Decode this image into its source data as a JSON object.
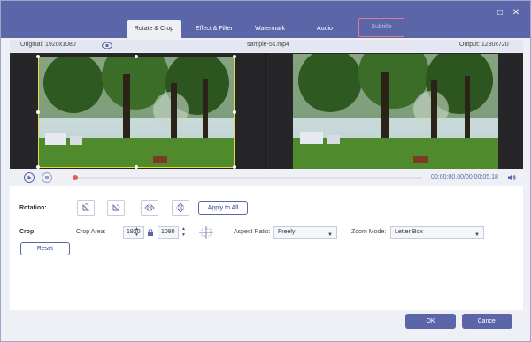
{
  "window": {
    "minimize_glyph": "□",
    "close_glyph": "✕"
  },
  "tabs": [
    {
      "label": "Rotate & Crop"
    },
    {
      "label": "Effect & Filter"
    },
    {
      "label": "Watermark"
    },
    {
      "label": "Audio"
    },
    {
      "label": "Subtitle"
    }
  ],
  "info": {
    "original": "Original: 1920x1080",
    "filename": "sample-5s.mp4",
    "output": "Output: 1280x720"
  },
  "playback": {
    "time": "00:00:00.00/00:00:05.18",
    "progress": 0.0
  },
  "rotation": {
    "label": "Rotation:",
    "apply_all": "Apply to All"
  },
  "crop": {
    "label": "Crop:",
    "area_label": "Crop Area:",
    "width": "1920",
    "height": "1080",
    "aspect_label": "Aspect Ratio:",
    "aspect_value": "Freely",
    "zoom_label": "Zoom Mode:",
    "zoom_value": "Letter Box",
    "reset": "Reset"
  },
  "footer": {
    "ok": "OK",
    "cancel": "Cancel"
  },
  "colors": {
    "accent": "#5b66a8",
    "crop_border": "#e8d84a",
    "progress_dot": "#e85a4f"
  }
}
